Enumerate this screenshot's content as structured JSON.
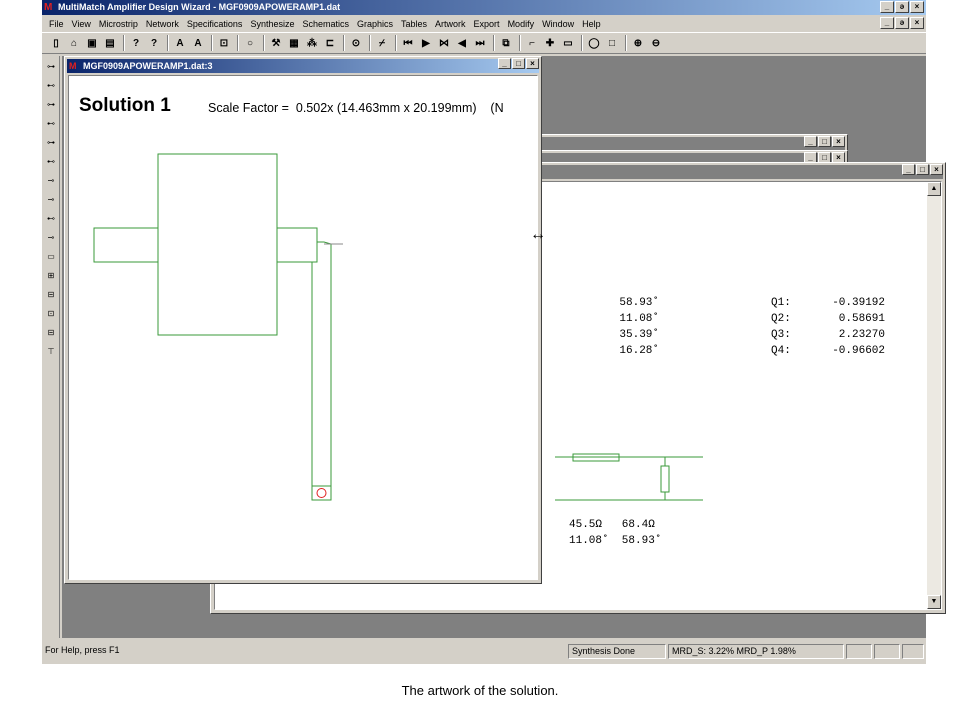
{
  "app": {
    "title": "MultiMatch Amplifier Design Wizard - MGF0909APOWERAMP1.dat",
    "icon_glyph": "M"
  },
  "window_buttons": {
    "minimize": "_",
    "restore": "ǝ",
    "close": "×",
    "maximize": "□"
  },
  "menu": [
    "File",
    "View",
    "Microstrip",
    "Network",
    "Specifications",
    "Synthesize",
    "Schematics",
    "Graphics",
    "Tables",
    "Artwork",
    "Export",
    "Modify",
    "Window",
    "Help"
  ],
  "toolbar_icons": [
    "new-file-icon",
    "open-folder-icon",
    "save-icon",
    "print-icon",
    "help-icon",
    "context-help-icon",
    "text-a-icon",
    "text-a-small-icon",
    "fit-icon",
    "circle-icon",
    "tools-icon",
    "grid-icon",
    "network-icon",
    "layout-icon",
    "target-icon",
    "probe-icon",
    "first-icon",
    "play-icon",
    "step-icon",
    "prev-icon",
    "last-icon",
    "copy-icon",
    "branch-icon",
    "plus-icon",
    "list-icon",
    "ring-icon",
    "square-icon",
    "zoom-in-icon",
    "zoom-out-icon"
  ],
  "left_toolbar_icons": [
    "stub-a-icon",
    "stub-b-icon",
    "stub-c-icon",
    "stub-d-icon",
    "stub-e-icon",
    "stub-f-icon",
    "line-icon",
    "tee-icon",
    "series-icon",
    "shunt-icon",
    "resistor-icon",
    "box-plus-icon",
    "box-minus-icon",
    "box-dot-icon",
    "box-b-icon",
    "ground-icon"
  ],
  "artwork_window": {
    "title": "MGF0909APOWERAMP1.dat:3",
    "solution_label": "Solution 1",
    "scale_text": "Scale Factor =  0.502x (14.463mm x 20.199mm)    (N"
  },
  "results_window": {
    "angles": [
      "58.93˚",
      "11.08˚",
      "35.39˚",
      "16.28˚"
    ],
    "q_labels": [
      "Q1:",
      "Q2:",
      "Q3:",
      "Q4:"
    ],
    "q_values": [
      "-0.39192",
      "0.58691",
      "2.23270",
      "-0.96602"
    ],
    "bottom_row1": "45.5Ω   68.4Ω",
    "bottom_row2": "11.08˚  58.93˚"
  },
  "resize_cursor": "↔",
  "status": {
    "help": "For Help, press F1",
    "synthesis": "Synthesis Done",
    "mrd": "MRD_S:  3.22% MRD_P  1.98%"
  },
  "caption": "The artwork of the solution.",
  "colors": {
    "title_active": "#0a246a",
    "trace_green": "#3a9a3a",
    "via_red": "#e02020"
  }
}
